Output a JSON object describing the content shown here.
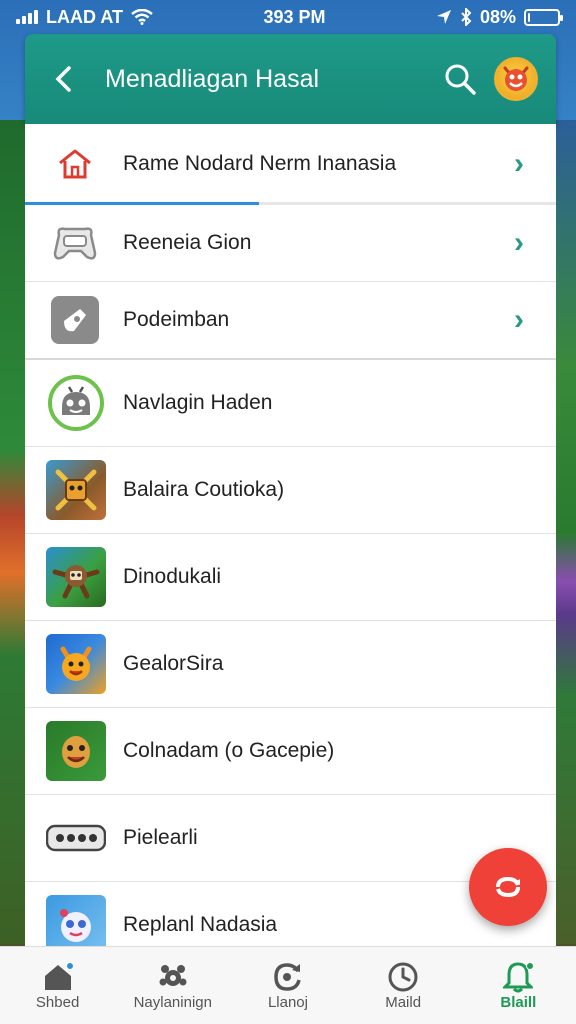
{
  "status_bar": {
    "carrier": "LAAD AT",
    "time": "393 PM",
    "battery": "08%",
    "battery_level": 0.08
  },
  "header": {
    "title": "Menadliagan Hasal"
  },
  "settings": [
    {
      "label": "Rame Nodard  Nerm Inanasia",
      "icon": "home-icon",
      "chevron": true,
      "progress": 0.44
    },
    {
      "label": "Reeneia Gion",
      "icon": "gamepad-icon",
      "chevron": true
    },
    {
      "label": "Podeimban",
      "icon": "app-store-icon",
      "chevron": true
    }
  ],
  "apps": [
    {
      "label": "Navlagin Haden",
      "icon": "android-icon"
    },
    {
      "label": "Balaira Coutioka)",
      "icon": "adventure-game-icon"
    },
    {
      "label": "Dinodukali",
      "icon": "monkey-game-icon"
    },
    {
      "label": "GealorSira",
      "icon": "fox-game-icon"
    },
    {
      "label": "Colnadam (o Gacepie)",
      "icon": "face-game-icon"
    },
    {
      "label": "Pielearli",
      "icon": "controller-icon"
    },
    {
      "label": "Replanl Nadasia",
      "icon": "creature-game-icon"
    }
  ],
  "bottom_nav": [
    {
      "label": "Shbed",
      "icon": "home-icon",
      "active": false,
      "badge": true
    },
    {
      "label": "Naylaninign",
      "icon": "gear-paw-icon",
      "active": false,
      "badge": false
    },
    {
      "label": "Llanoj",
      "icon": "refresh-icon",
      "active": false,
      "badge": false
    },
    {
      "label": "Maild",
      "icon": "clock-icon",
      "active": false,
      "badge": false
    },
    {
      "label": "Blaill",
      "icon": "bell-icon",
      "active": true,
      "badge": true
    }
  ],
  "colors": {
    "header": "#1f9a88",
    "accent": "#2a9a84",
    "fab": "#ef4137",
    "active_nav": "#1e9a55",
    "progress": "#2b8fe0"
  }
}
